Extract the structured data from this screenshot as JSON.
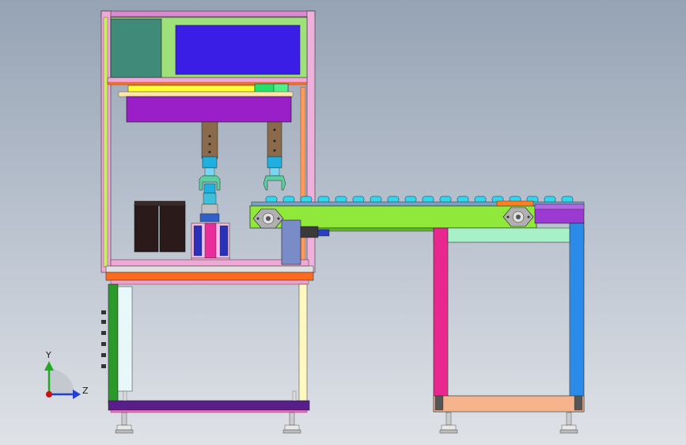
{
  "viewport": {
    "background_top": "#96a3b4",
    "background_bottom": "#dfe2e7"
  },
  "triad": {
    "y_label": "Y",
    "z_label": "Z",
    "y_color": "#22aa22",
    "z_color": "#1f3fd8",
    "x_color": "#cc1111"
  },
  "colors": {
    "frame_pink": "#f0a0d0",
    "panel_green": "#9ee07a",
    "panel_teal": "#3f8a78",
    "panel_blue": "#3a1ee6",
    "head_purple": "#9a1fc8",
    "rail_yellow": "#ffff33",
    "conveyor_green": "#8fe83a",
    "roller_cyan": "#33d8e8",
    "leg_magenta": "#e8278f",
    "leg_blue": "#2a8ce8",
    "base_orange": "#ff6b1e",
    "base_purple": "#5a1e8a",
    "bin_dark": "#2a1a1a",
    "gripper_cyan": "#1fb0e0",
    "foot_salmon": "#f6b48c"
  },
  "icons": {
    "triad": "axis-triad-icon",
    "leveling_foot": "leveling-foot-icon",
    "bearing": "flange-bearing-icon"
  }
}
